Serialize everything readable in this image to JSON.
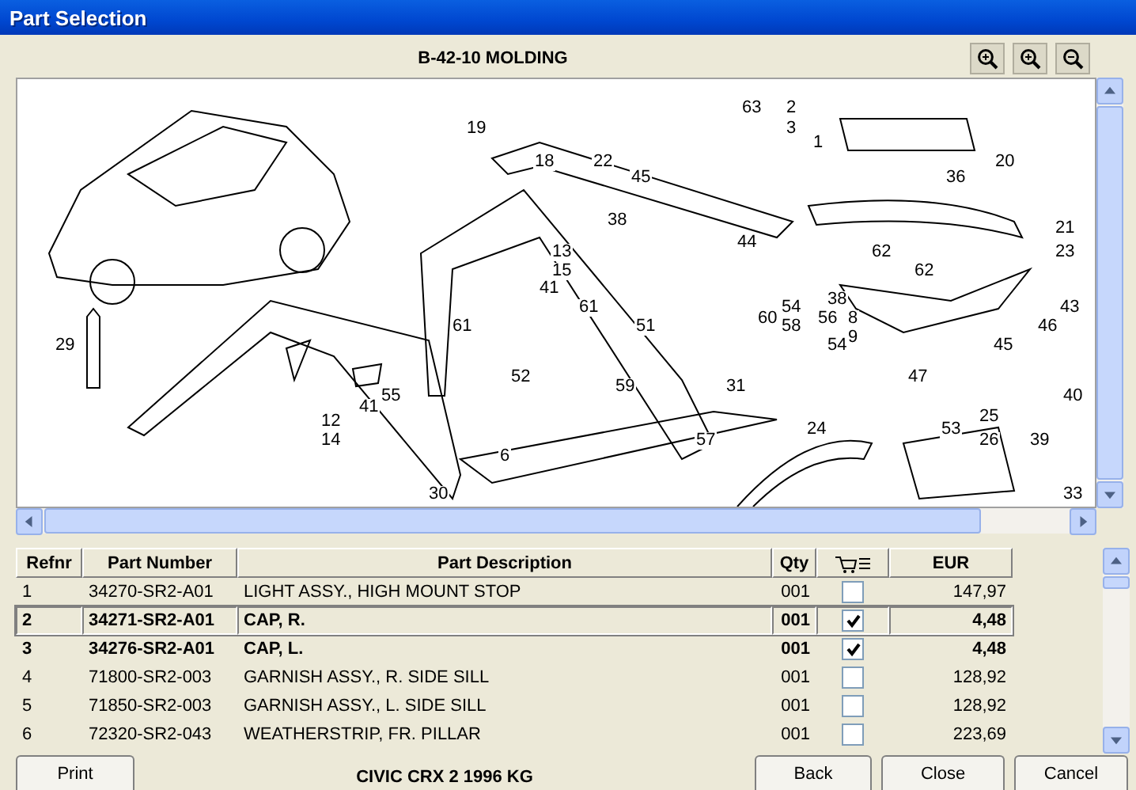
{
  "window": {
    "title": "Part Selection"
  },
  "diagram": {
    "title": "B-42-10 MOLDING",
    "callouts": [
      "63",
      "2",
      "19",
      "3",
      "1",
      "18",
      "22",
      "20",
      "45",
      "36",
      "38",
      "21",
      "44",
      "13",
      "62",
      "23",
      "15",
      "62",
      "41",
      "38",
      "61",
      "54",
      "43",
      "60",
      "56",
      "8",
      "61",
      "51",
      "58",
      "46",
      "9",
      "29",
      "54",
      "45",
      "52",
      "47",
      "59",
      "31",
      "55",
      "40",
      "41",
      "25",
      "12",
      "24",
      "53",
      "14",
      "57",
      "26",
      "39",
      "6",
      "30",
      "33"
    ]
  },
  "table": {
    "columns": [
      "Refnr",
      "Part Number",
      "Part Description",
      "Qty",
      "EUR"
    ],
    "rows": [
      {
        "refnr": "1",
        "part_number": "34270-SR2-A01",
        "description": "LIGHT ASSY., HIGH MOUNT STOP",
        "qty": "001",
        "checked": false,
        "selected": false,
        "price": "147,97"
      },
      {
        "refnr": "2",
        "part_number": "34271-SR2-A01",
        "description": "CAP, R.",
        "qty": "001",
        "checked": true,
        "selected": true,
        "price": "4,48"
      },
      {
        "refnr": "3",
        "part_number": "34276-SR2-A01",
        "description": "CAP, L.",
        "qty": "001",
        "checked": true,
        "selected": false,
        "price": "4,48"
      },
      {
        "refnr": "4",
        "part_number": "71800-SR2-003",
        "description": "GARNISH ASSY., R. SIDE SILL",
        "qty": "001",
        "checked": false,
        "selected": false,
        "price": "128,92"
      },
      {
        "refnr": "5",
        "part_number": "71850-SR2-003",
        "description": "GARNISH ASSY., L. SIDE SILL",
        "qty": "001",
        "checked": false,
        "selected": false,
        "price": "128,92"
      },
      {
        "refnr": "6",
        "part_number": "72320-SR2-043",
        "description": "WEATHERSTRIP, FR. PILLAR",
        "qty": "001",
        "checked": false,
        "selected": false,
        "price": "223,69"
      }
    ]
  },
  "footer": {
    "print": "Print",
    "vehicle": "CIVIC CRX  2  1996  KG",
    "back": "Back",
    "close": "Close",
    "cancel": "Cancel"
  }
}
